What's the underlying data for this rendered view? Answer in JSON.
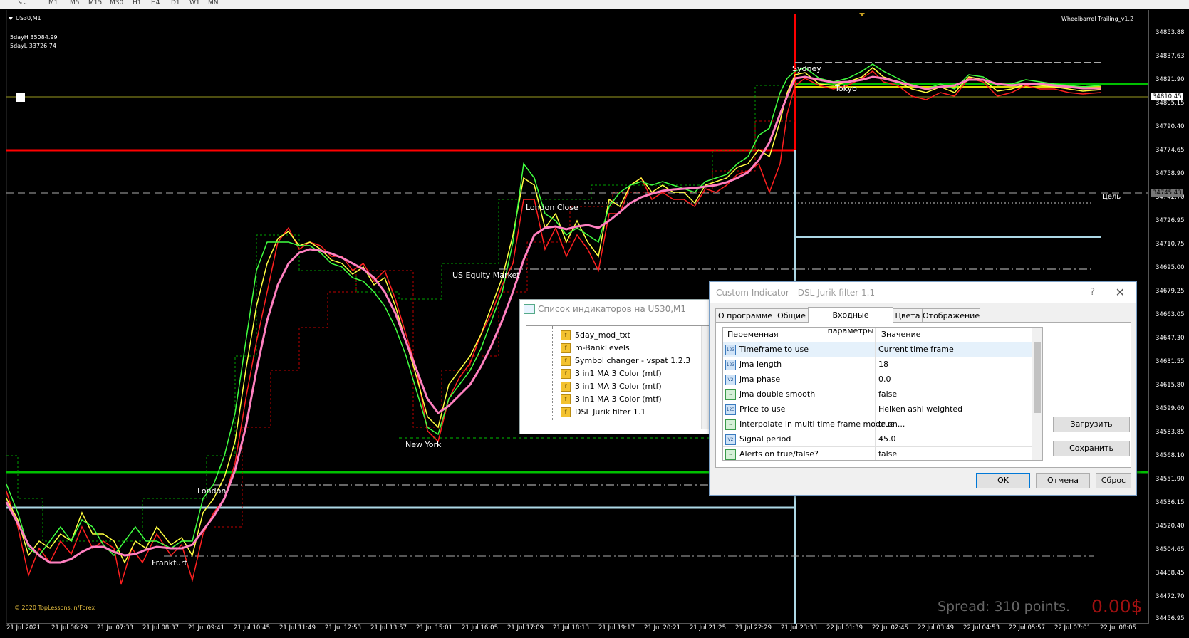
{
  "toolbar": {
    "timeframes": [
      "M1",
      "M5",
      "M15",
      "M30",
      "H1",
      "H4",
      "D1",
      "W1",
      "MN"
    ]
  },
  "chart": {
    "symbol_label": "US30,M1",
    "indicator_name": "Wheelbarrel Trailing_v1.2",
    "five_day_high": "5dayH 35084.99",
    "five_day_low": "5dayL 33726.74",
    "target_label": "Цель",
    "copyright": "© 2020 TopLessons.In/Forex",
    "spread": "Spread: 310 points.",
    "profit": "0.00$",
    "sessions": {
      "sydney": "Sydney",
      "tokyo": "Tokyo",
      "london_close": "London Close",
      "us_equity": "US Equity Market",
      "new_york": "New York",
      "london": "London",
      "frankfurt": "Frankfurt"
    },
    "price_labels": [
      "34853.88",
      "34837.63",
      "34821.90",
      "34805.15",
      "34790.40",
      "34774.65",
      "34758.90",
      "34742.70",
      "34726.95",
      "34710.75",
      "34695.00",
      "34679.25",
      "34663.05",
      "34647.30",
      "34631.55",
      "34615.80",
      "34599.60",
      "34583.85",
      "34568.10",
      "34551.90",
      "34536.15",
      "34520.40",
      "34504.65",
      "34488.45",
      "34472.70",
      "34456.95"
    ],
    "current_price": "34810.45",
    "target_price": "34745.43",
    "time_labels": [
      "21 Jul 2021",
      "21 Jul 06:29",
      "21 Jul 07:33",
      "21 Jul 08:37",
      "21 Jul 09:41",
      "21 Jul 10:45",
      "21 Jul 11:49",
      "21 Jul 12:53",
      "21 Jul 13:57",
      "21 Jul 15:01",
      "21 Jul 16:05",
      "21 Jul 17:09",
      "21 Jul 18:13",
      "21 Jul 19:17",
      "21 Jul 20:21",
      "21 Jul 21:25",
      "21 Jul 22:29",
      "21 Jul 23:33",
      "22 Jul 01:39",
      "22 Jul 02:45",
      "22 Jul 03:49",
      "22 Jul 04:53",
      "22 Jul 05:57",
      "22 Jul 07:01",
      "22 Jul 08:05"
    ]
  },
  "indicator_list": {
    "title": "Список индикаторов на US30,M1",
    "items": [
      "5day_mod_txt",
      "m-BankLevels",
      "Symbol changer - vspat 1.2.3",
      "3 in1 MA 3 Color (mtf)",
      "3 in1 MA 3 Color (mtf)",
      "3 in1 MA 3 Color (mtf)",
      "DSL Jurik filter 1.1"
    ]
  },
  "dialog": {
    "title": "Custom Indicator - DSL Jurik filter 1.1",
    "help": "?",
    "close": "✕",
    "tabs": [
      "О программе",
      "Общие",
      "Входные параметры",
      "Цвета",
      "Отображение"
    ],
    "col_variable": "Переменная",
    "col_value": "Значение",
    "params": [
      {
        "icon": "123",
        "name": "Timeframe to use",
        "value": "Current time frame"
      },
      {
        "icon": "123",
        "name": "jma length",
        "value": "18"
      },
      {
        "icon": "V2",
        "name": "jma  phase",
        "value": "0.0"
      },
      {
        "icon": "~",
        "name": "jma  double smooth",
        "value": "false"
      },
      {
        "icon": "123",
        "name": "Price to use",
        "value": "Heiken ashi weighted"
      },
      {
        "icon": "~",
        "name": "Interpolate in multi time frame mode on...",
        "value": "true"
      },
      {
        "icon": "V2",
        "name": "Signal period",
        "value": "45.0"
      },
      {
        "icon": "~",
        "name": "Alerts on true/false?",
        "value": "false"
      }
    ],
    "load": "Загрузить",
    "save": "Сохранить",
    "ok": "OK",
    "cancel": "Отмена",
    "reset": "Сброс"
  }
}
